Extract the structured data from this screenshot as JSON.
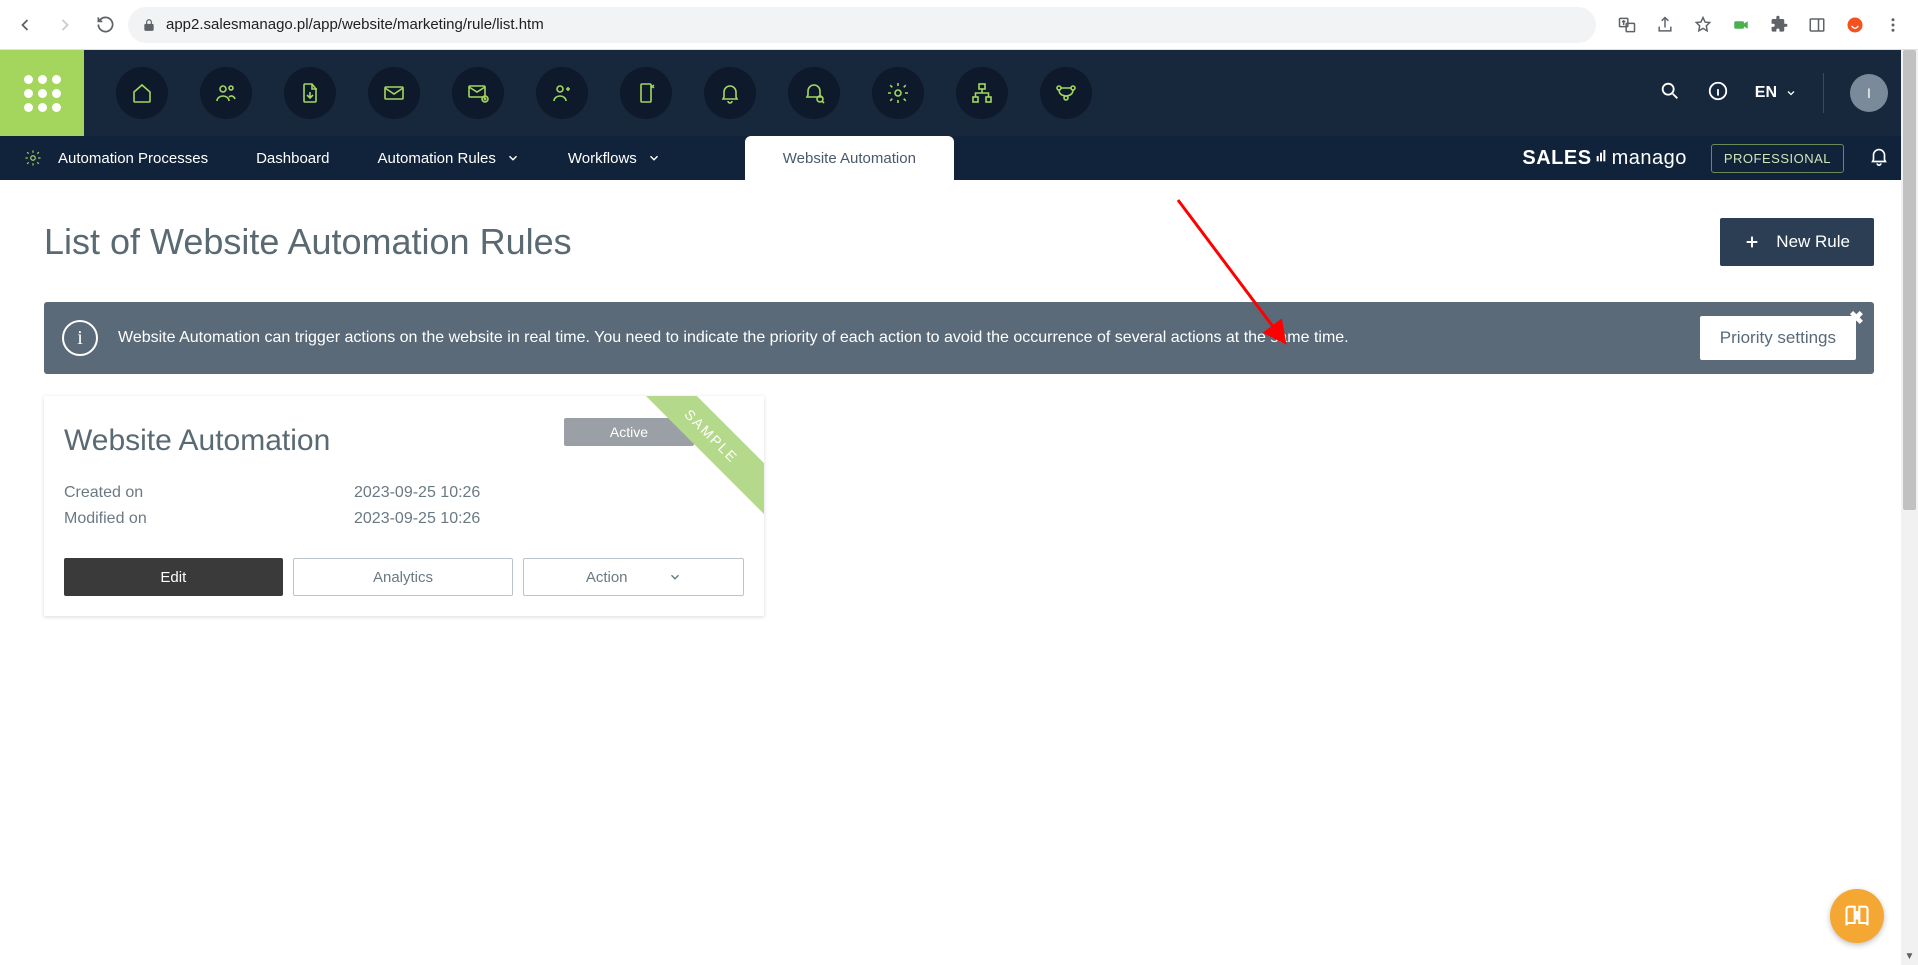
{
  "browser": {
    "url": "app2.salesmanago.pl/app/website/marketing/rule/list.htm"
  },
  "topnav": {
    "language": "EN",
    "avatar_initial": "I"
  },
  "subnav": {
    "section_label": "Automation Processes",
    "items": [
      "Dashboard",
      "Automation Rules",
      "Workflows"
    ],
    "active_tab": "Website Automation",
    "brand_strong": "SALES",
    "brand_light": "manago",
    "plan_badge": "PROFESSIONAL"
  },
  "page": {
    "title": "List of Website Automation Rules",
    "new_rule_label": "New Rule"
  },
  "banner": {
    "text": "Website Automation can trigger actions on the website in real time. You need to indicate the priority of each action to avoid the occurrence of several actions at the same time.",
    "button": "Priority settings"
  },
  "card": {
    "title": "Website Automation",
    "ribbon": "SAMPLE",
    "status_pill": "Active",
    "created_label": "Created on",
    "created_value": "2023-09-25 10:26",
    "modified_label": "Modified on",
    "modified_value": "2023-09-25 10:26",
    "edit_label": "Edit",
    "analytics_label": "Analytics",
    "action_label": "Action"
  }
}
